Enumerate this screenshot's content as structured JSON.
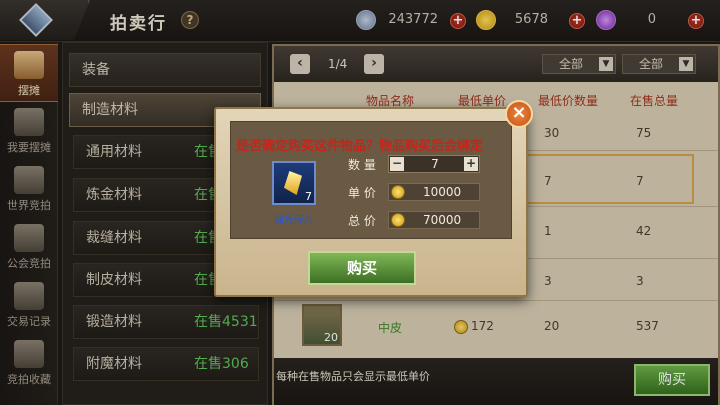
{
  "header": {
    "title": "拍卖行",
    "help": "?",
    "currencies": [
      {
        "icon": "silver-coin-icon",
        "value": "243772",
        "color": "#7a8ca8"
      },
      {
        "icon": "gold-coin-icon",
        "value": "5678",
        "color": "#e8b520"
      },
      {
        "icon": "purple-gem-icon",
        "value": "0",
        "color": "#9b4ad0"
      }
    ]
  },
  "leftnav": {
    "items": [
      {
        "label": "摆摊",
        "icon": "stall-cart-icon",
        "active": true
      },
      {
        "label": "我要摆摊",
        "icon": "merchant-icon",
        "active": false
      },
      {
        "label": "世界竞拍",
        "icon": "scale-icon",
        "active": false
      },
      {
        "label": "公会竞拍",
        "icon": "guild-scale-icon",
        "active": false
      },
      {
        "label": "交易记录",
        "icon": "ledger-icon",
        "active": false
      },
      {
        "label": "竞拍收藏",
        "icon": "favorite-icon",
        "active": false
      }
    ]
  },
  "categories": {
    "top": [
      {
        "label": "装备"
      },
      {
        "label": "制造材料"
      }
    ],
    "sub": [
      {
        "name": "通用材料",
        "sale": "在售"
      },
      {
        "name": "炼金材料",
        "sale": "在售"
      },
      {
        "name": "裁缝材料",
        "sale": "在售"
      },
      {
        "name": "制皮材料",
        "sale": "在售"
      },
      {
        "name": "锻造材料",
        "sale": "在售4531"
      },
      {
        "name": "附魔材料",
        "sale": "在售306"
      }
    ]
  },
  "table": {
    "page": "1/4",
    "filter1": "全部",
    "filter2": "全部",
    "headers": [
      "物品名称",
      "最低单价",
      "最低价数量",
      "在售总量"
    ],
    "rows": [
      {
        "min_qty": "30",
        "total": "75"
      },
      {
        "min_qty": "7",
        "total": "7"
      },
      {
        "min_qty": "1",
        "total": "42"
      },
      {
        "min_qty": "3",
        "total": "3"
      },
      {
        "name": "中皮",
        "price": "172",
        "min_qty": "20",
        "total": "537",
        "count": "20"
      }
    ],
    "footnote": "每种在售物品只会显示最低单价",
    "buy": "购买"
  },
  "modal": {
    "question": "是否确定购买这件物品？物品购买后会绑定",
    "close": "×",
    "item_name": "强光碎片",
    "item_qty": "7",
    "qty_label": "数 量",
    "qty_value": "7",
    "minus": "−",
    "plus": "+",
    "unit_label": "单 价",
    "unit_price": "10000",
    "total_label": "总 价",
    "total_price": "70000",
    "buy": "购买"
  }
}
